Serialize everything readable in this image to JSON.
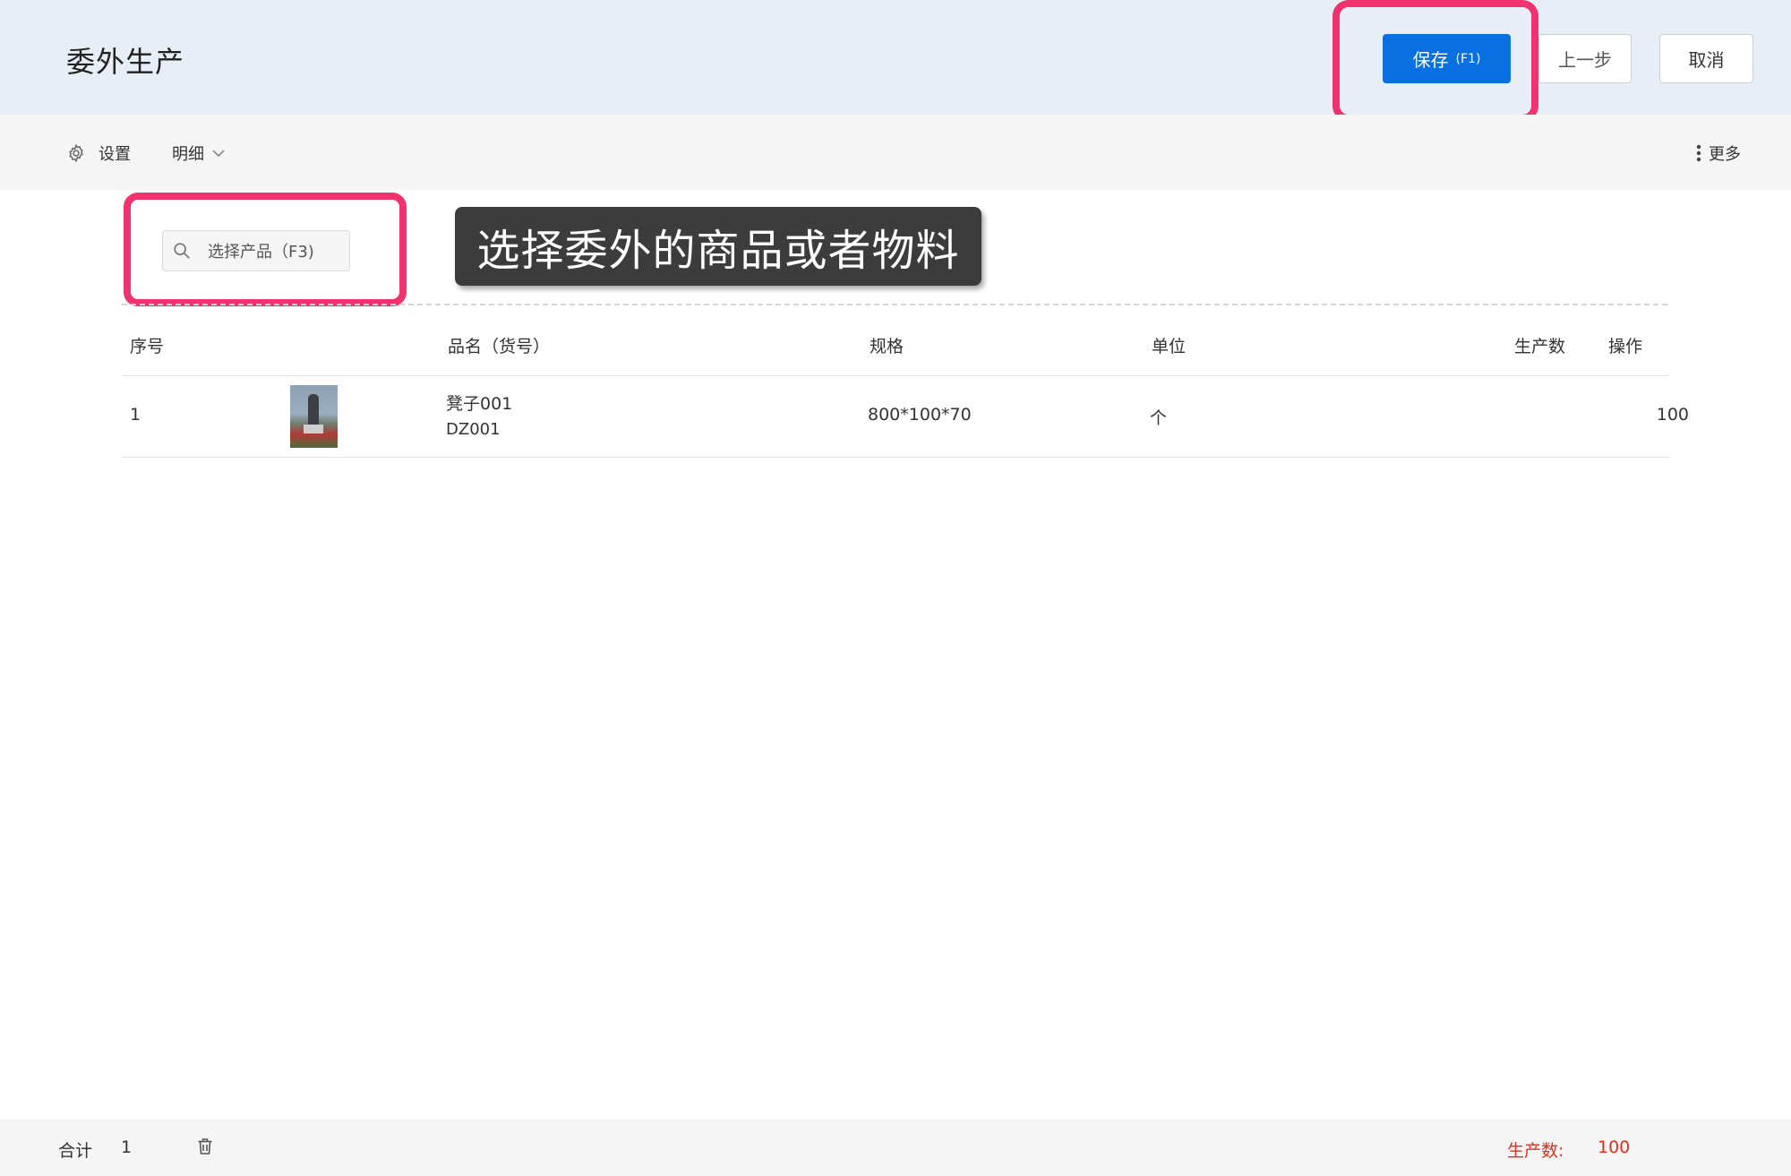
{
  "header": {
    "title": "委外生产",
    "save_label": "保存",
    "save_shortcut": "(F1)",
    "prev_label": "上一步",
    "cancel_label": "取消"
  },
  "toolbar": {
    "settings_label": "设置",
    "detail_label": "明细",
    "more_label": "更多"
  },
  "search": {
    "label": "选择产品（F3)"
  },
  "annotation": {
    "text": "选择委外的商品或者物料"
  },
  "table": {
    "headers": {
      "index": "序号",
      "name": "品名（货号）",
      "spec": "规格",
      "unit": "单位",
      "qty": "生产数",
      "action": "操作"
    },
    "rows": [
      {
        "index": "1",
        "name": "凳子001",
        "code": "DZ001",
        "spec": "800*100*70",
        "unit": "个",
        "qty": "100"
      }
    ]
  },
  "footer": {
    "total_label": "合计",
    "total_value": "1",
    "production_label": "生产数:",
    "production_value": "100"
  },
  "colors": {
    "primary": "#0a6fe0",
    "highlight": "#f0336f",
    "emphasis_text": "#e0301e",
    "header_bg": "#e8eef5"
  }
}
